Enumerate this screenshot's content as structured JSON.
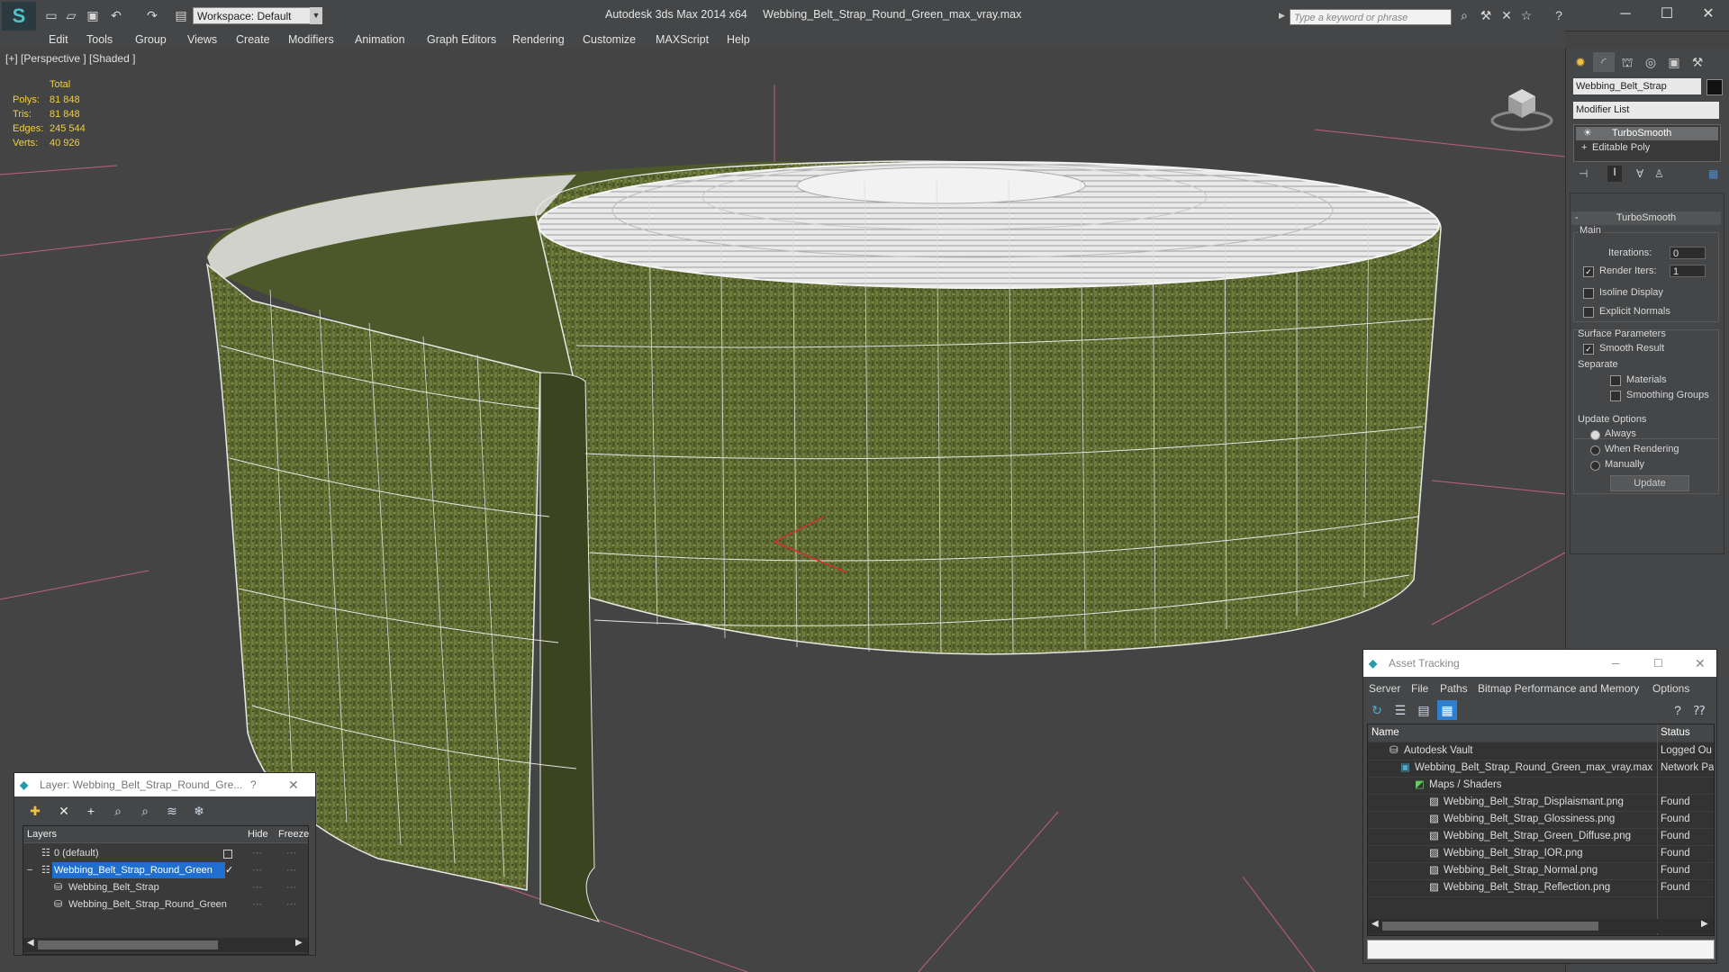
{
  "titlebar": {
    "app_name": "Autodesk 3ds Max  2014 x64",
    "file_name": "Webbing_Belt_Strap_Round_Green_max_vray.max",
    "workspace": "Workspace: Default",
    "search_placeholder": "Type a keyword or phrase"
  },
  "menu": [
    "Edit",
    "Tools",
    "Group",
    "Views",
    "Create",
    "Modifiers",
    "Animation",
    "Graph Editors",
    "Rendering",
    "Customize",
    "MAXScript",
    "Help"
  ],
  "viewport": {
    "label": "[+] [Perspective ] [Shaded ]",
    "stats": {
      "header": "Total",
      "rows": [
        {
          "label": "Polys:",
          "value": "81 848"
        },
        {
          "label": "Tris:",
          "value": "81 848"
        },
        {
          "label": "Edges:",
          "value": "245 544"
        },
        {
          "label": "Verts:",
          "value": "40 926"
        }
      ]
    }
  },
  "command_panel": {
    "object_name": "Webbing_Belt_Strap",
    "modifier_list": "Modifier List",
    "stack": [
      "TurboSmooth",
      "Editable Poly"
    ],
    "rollout_title": "TurboSmooth",
    "main_label": "Main",
    "iterations_label": "Iterations:",
    "iterations_value": "0",
    "render_iters_label": "Render Iters:",
    "render_iters_value": "1",
    "isoline_label": "Isoline Display",
    "explicit_normals_label": "Explicit Normals",
    "surface_params_label": "Surface Parameters",
    "smooth_result_label": "Smooth Result",
    "separate_label": "Separate",
    "materials_label": "Materials",
    "smoothing_groups_label": "Smoothing Groups",
    "update_options_label": "Update Options",
    "always_label": "Always",
    "when_rendering_label": "When Rendering",
    "manually_label": "Manually",
    "update_button": "Update"
  },
  "layer_window": {
    "title": "Layer: Webbing_Belt_Strap_Round_Gre...",
    "help": "?",
    "col_layers": "Layers",
    "col_hide": "Hide",
    "col_freeze": "Freeze",
    "rows": [
      "0 (default)",
      "Webbing_Belt_Strap_Round_Green",
      "Webbing_Belt_Strap",
      "Webbing_Belt_Strap_Round_Green"
    ]
  },
  "asset_window": {
    "title": "Asset Tracking",
    "menu": [
      "Server",
      "File",
      "Paths",
      "Bitmap Performance and Memory",
      "Options"
    ],
    "col_name": "Name",
    "col_status": "Status",
    "rows": [
      {
        "name": "Autodesk Vault",
        "status": "Logged Ou"
      },
      {
        "name": "Webbing_Belt_Strap_Round_Green_max_vray.max",
        "status": "Network Pa"
      },
      {
        "name": "Maps / Shaders",
        "status": ""
      },
      {
        "name": "Webbing_Belt_Strap_Displaismant.png",
        "status": "Found"
      },
      {
        "name": "Webbing_Belt_Strap_Glossiness.png",
        "status": "Found"
      },
      {
        "name": "Webbing_Belt_Strap_Green_Diffuse.png",
        "status": "Found"
      },
      {
        "name": "Webbing_Belt_Strap_IOR.png",
        "status": "Found"
      },
      {
        "name": "Webbing_Belt_Strap_Normal.png",
        "status": "Found"
      },
      {
        "name": "Webbing_Belt_Strap_Reflection.png",
        "status": "Found"
      }
    ]
  },
  "colors": {
    "stats_yellow": "#f0d040",
    "selection_blue": "#1e6fd0",
    "belt_green": "#59662f"
  }
}
